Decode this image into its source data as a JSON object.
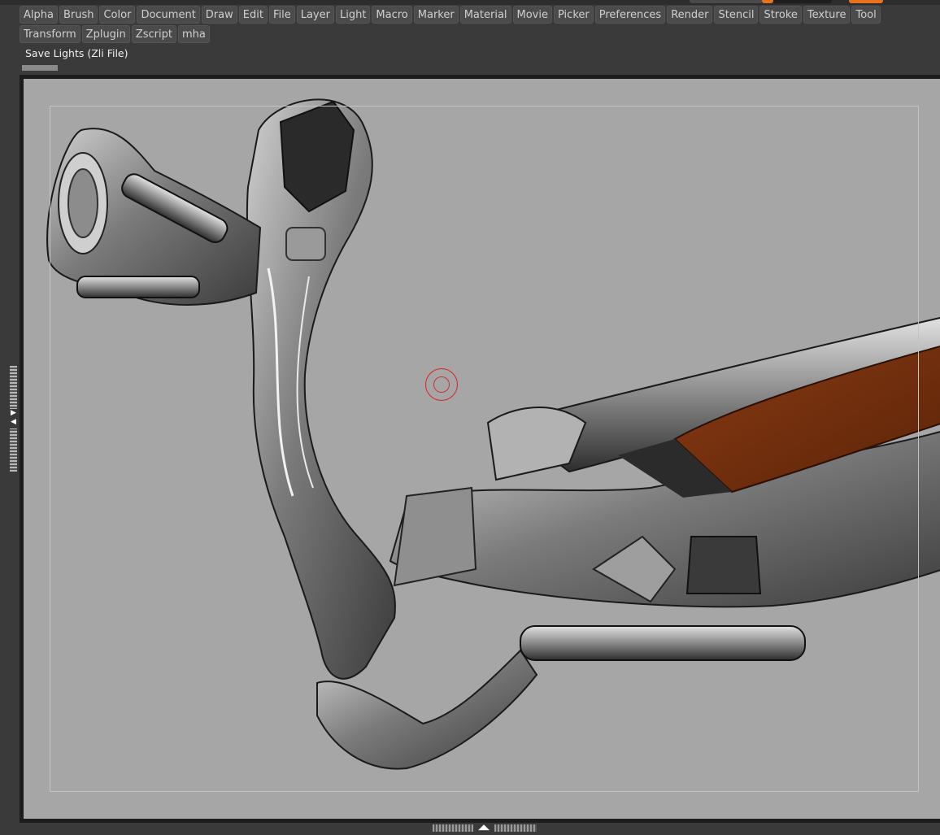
{
  "menu": {
    "items": [
      "Alpha",
      "Brush",
      "Color",
      "Document",
      "Draw",
      "Edit",
      "File",
      "Layer",
      "Light",
      "Macro",
      "Marker",
      "Material",
      "Movie",
      "Picker",
      "Preferences",
      "Render",
      "Stencil",
      "Stroke",
      "Texture",
      "Tool",
      "Transform",
      "Zplugin",
      "Zscript",
      "mha"
    ]
  },
  "status": {
    "text": "Save Lights (Zli File)"
  },
  "colors": {
    "canvas_bg": "#a6a6a6",
    "ui_bg": "#3a3a3a",
    "accent_orange": "#e8731c",
    "cursor_red": "#d22222"
  },
  "icons": {
    "left_handle": "collapse-left-tray-handle",
    "bottom_handle": "collapse-bottom-tray-handle",
    "cursor": "brush-cursor-ring"
  }
}
